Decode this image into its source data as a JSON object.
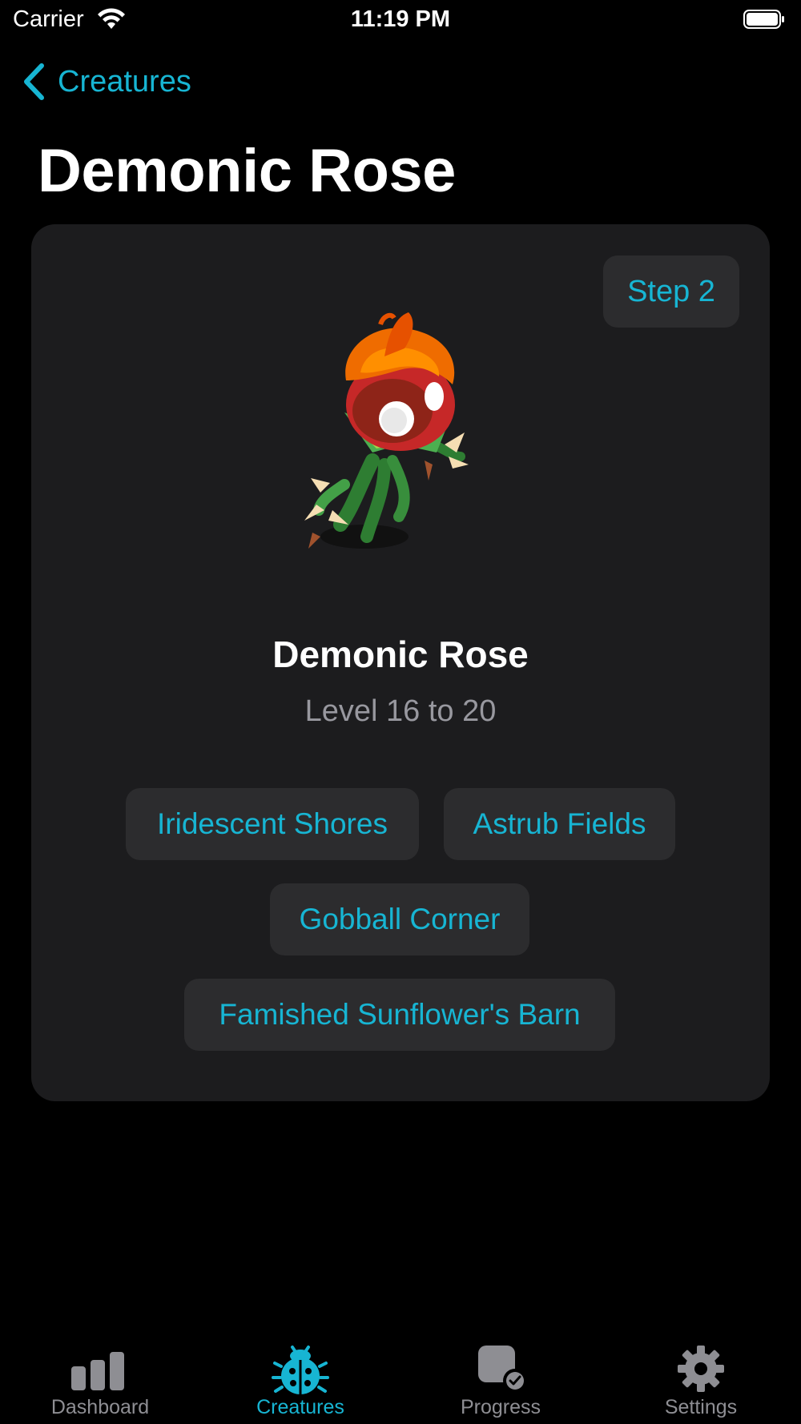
{
  "status_bar": {
    "carrier": "Carrier",
    "time": "11:19 PM"
  },
  "nav": {
    "back_label": "Creatures"
  },
  "page": {
    "title": "Demonic Rose"
  },
  "card": {
    "step_label": "Step 2",
    "creature_name": "Demonic Rose",
    "level_text": "Level 16 to 20",
    "areas": [
      "Iridescent Shores",
      "Astrub Fields",
      "Gobball Corner",
      "Famished Sunflower's Barn"
    ]
  },
  "tabs": [
    {
      "label": "Dashboard",
      "icon": "chart-bar-icon",
      "active": false
    },
    {
      "label": "Creatures",
      "icon": "ladybug-icon",
      "active": true
    },
    {
      "label": "Progress",
      "icon": "badge-check-icon",
      "active": false
    },
    {
      "label": "Settings",
      "icon": "gear-icon",
      "active": false
    }
  ],
  "colors": {
    "accent": "#17b5d3",
    "background": "#000000",
    "card": "#1c1c1e",
    "chip": "#2c2c2e",
    "secondary_text": "#98989f",
    "inactive_tab": "#8e8e93"
  }
}
